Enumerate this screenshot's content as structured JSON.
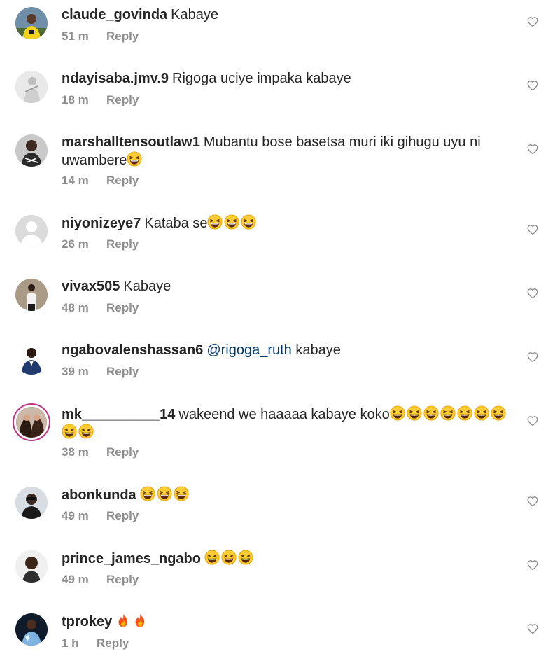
{
  "comments": [
    {
      "username": "claude_govinda",
      "text": "Kabaye",
      "time": "51 m",
      "reply": "Reply"
    },
    {
      "username": "ndayisaba.jmv.9",
      "text": "Rigoga uciye impaka kabaye",
      "time": "18 m",
      "reply": "Reply"
    },
    {
      "username": "marshalltensoutlaw1",
      "text": "Mubantu bose basetsa muri iki gihugu uyu ni uwambere",
      "time": "14 m",
      "reply": "Reply"
    },
    {
      "username": "niyonizeye7",
      "text": "Kataba se",
      "time": "26 m",
      "reply": "Reply"
    },
    {
      "username": "vivax505",
      "text": "Kabaye",
      "time": "48 m",
      "reply": "Reply"
    },
    {
      "username": "ngabovalenshassan6",
      "mention": "@rigoga_ruth",
      "text": "kabaye",
      "time": "39 m",
      "reply": "Reply"
    },
    {
      "username": "mk__________14",
      "text": "wakeend we haaaaa kabaye koko",
      "time": "38 m",
      "reply": "Reply"
    },
    {
      "username": "abonkunda",
      "text": "",
      "time": "49 m",
      "reply": "Reply"
    },
    {
      "username": "prince_james_ngabo",
      "text": "",
      "time": "49 m",
      "reply": "Reply"
    },
    {
      "username": "tprokey",
      "text": "",
      "time": "1 h",
      "reply": "Reply"
    }
  ],
  "icons": {
    "like": "heart-outline-icon",
    "laugh": "grinning-squinting-face-emoji",
    "fire": "fire-emoji"
  },
  "colors": {
    "username": "#262626",
    "meta": "#8e8e8e",
    "mention": "#00376b",
    "story_ring": "#c13584"
  }
}
